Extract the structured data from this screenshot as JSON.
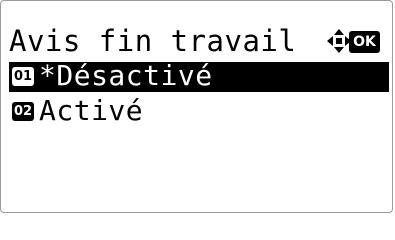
{
  "title": "Avis fin travail",
  "icons": {
    "nav": "four-way-arrow-icon",
    "ok": "OK"
  },
  "items": [
    {
      "number": "01",
      "label": "*Désactivé",
      "selected": true
    },
    {
      "number": "02",
      "label": " Activé",
      "selected": false
    }
  ]
}
